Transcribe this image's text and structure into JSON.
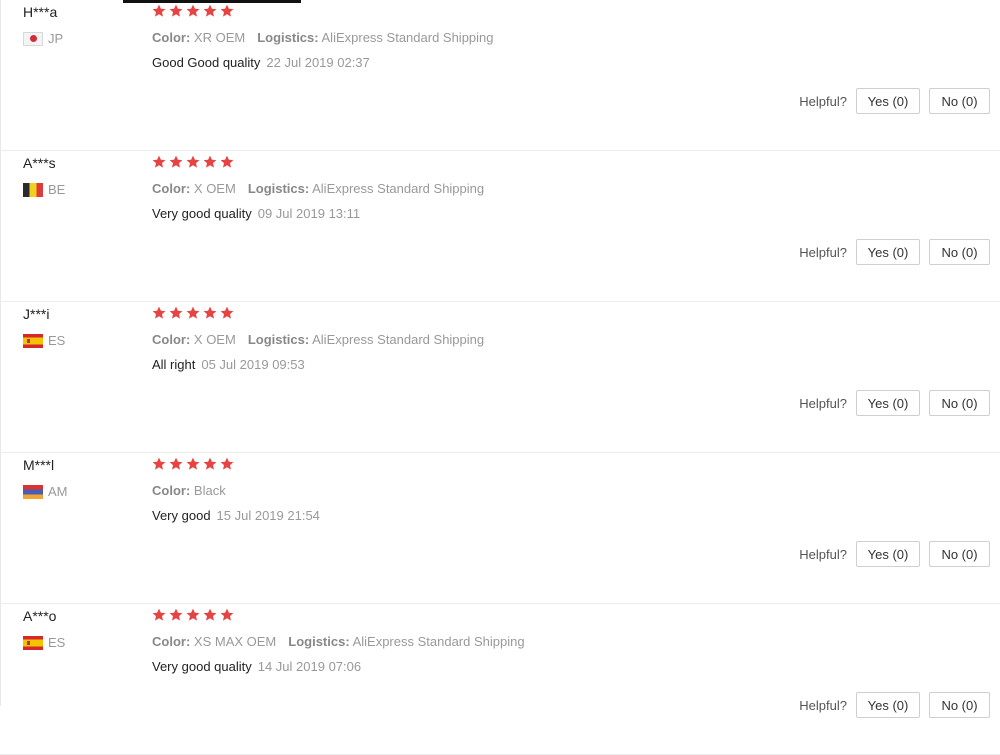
{
  "labels": {
    "color": "Color:",
    "logistics": "Logistics:",
    "helpful": "Helpful?"
  },
  "star_color": "#e84343",
  "reviews": [
    {
      "user": "H***a",
      "country": "JP",
      "flag": "jp",
      "rating": 5,
      "color_value": "XR OEM",
      "logistics_value": "AliExpress Standard Shipping",
      "feedback": "Good Good quality",
      "date": "22 Jul 2019 02:37",
      "yes_label": "Yes (0)",
      "no_label": "No (0)"
    },
    {
      "user": "A***s",
      "country": "BE",
      "flag": "be",
      "rating": 5,
      "color_value": "X OEM",
      "logistics_value": "AliExpress Standard Shipping",
      "feedback": "Very good quality",
      "date": "09 Jul 2019 13:11",
      "yes_label": "Yes (0)",
      "no_label": "No (0)"
    },
    {
      "user": "J***i",
      "country": "ES",
      "flag": "es",
      "rating": 5,
      "color_value": "X OEM",
      "logistics_value": "AliExpress Standard Shipping",
      "feedback": "All right",
      "date": "05 Jul 2019 09:53",
      "yes_label": "Yes (0)",
      "no_label": "No (0)"
    },
    {
      "user": "M***l",
      "country": "AM",
      "flag": "am",
      "rating": 5,
      "color_value": "Black",
      "logistics_value": "",
      "feedback": "Very good",
      "date": "15 Jul 2019 21:54",
      "yes_label": "Yes (0)",
      "no_label": "No (0)"
    },
    {
      "user": "A***o",
      "country": "ES",
      "flag": "es",
      "rating": 5,
      "color_value": "XS MAX OEM",
      "logistics_value": "AliExpress Standard Shipping",
      "feedback": "Very good quality",
      "date": "14 Jul 2019 07:06",
      "yes_label": "Yes (0)",
      "no_label": "No (0)"
    }
  ]
}
